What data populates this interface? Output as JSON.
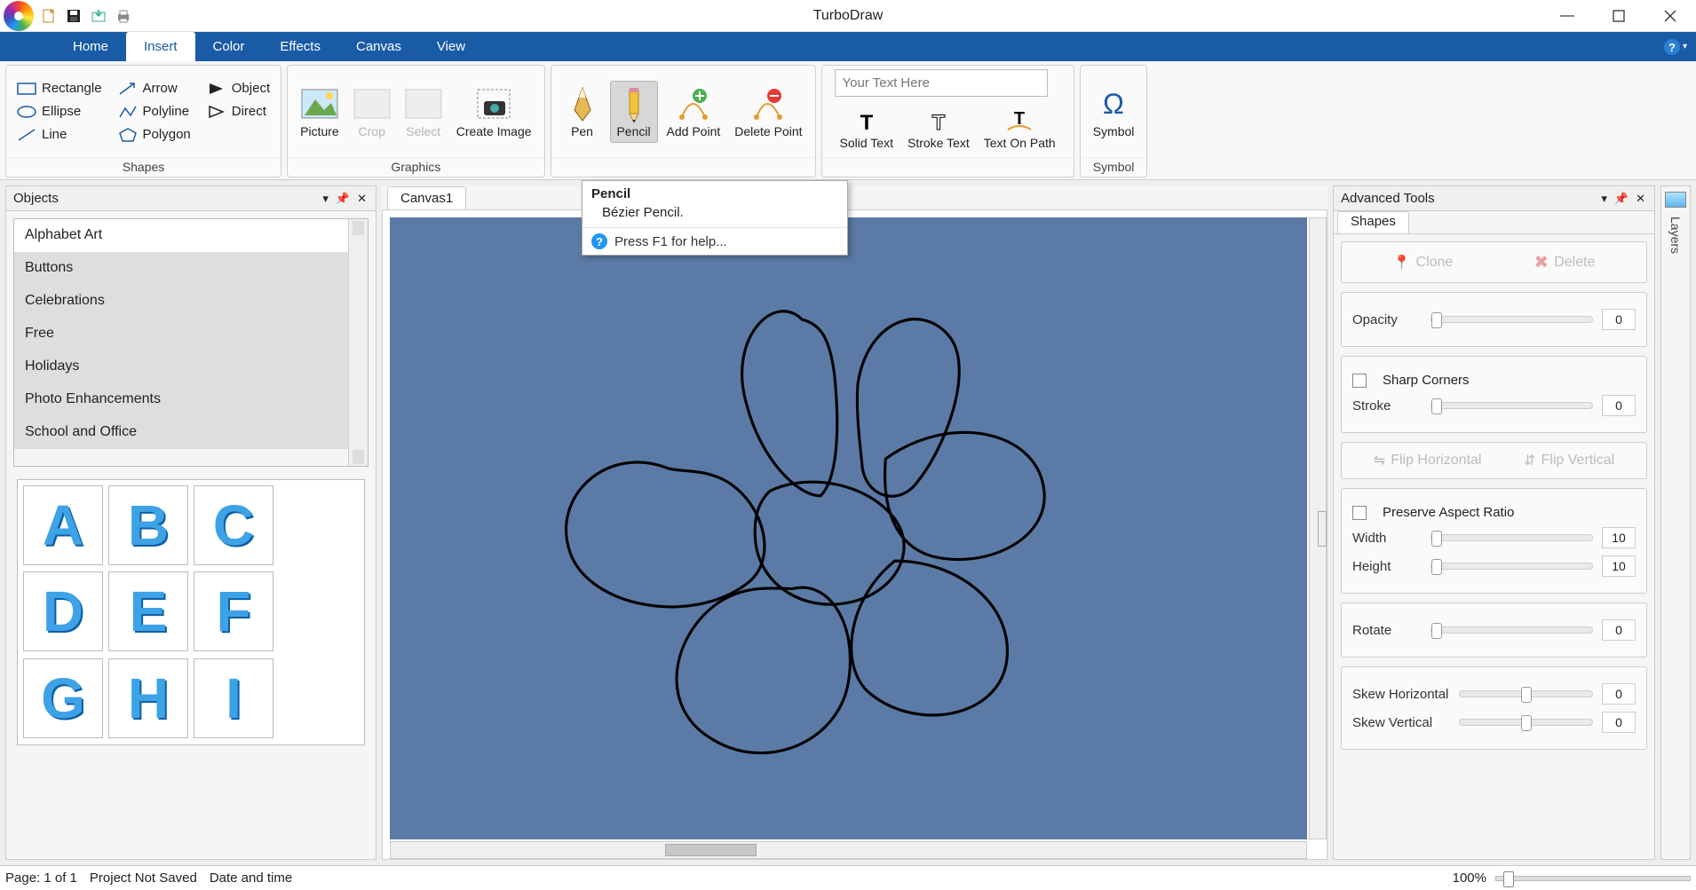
{
  "app": {
    "title": "TurboDraw"
  },
  "qat": {
    "items": [
      "new",
      "save",
      "import",
      "print"
    ]
  },
  "window_controls": {
    "min": "–",
    "max": "□",
    "close": "✕"
  },
  "ribbon": {
    "tabs": [
      "Home",
      "Insert",
      "Color",
      "Effects",
      "Canvas",
      "View"
    ],
    "active_index": 1,
    "groups": {
      "shapes": {
        "label": "Shapes",
        "items": [
          "Rectangle",
          "Arrow",
          "Object",
          "Ellipse",
          "Polyline",
          "Direct",
          "Line",
          "Polygon"
        ]
      },
      "graphics": {
        "label": "Graphics",
        "items": [
          "Picture",
          "Crop",
          "Select",
          "Create Image"
        ]
      },
      "draw": {
        "label": "",
        "items": [
          "Pen",
          "Pencil",
          "Add Point",
          "Delete Point"
        ],
        "active_tool": "Pencil"
      },
      "text": {
        "label": "",
        "placeholder": "Your Text Here",
        "value": "",
        "items": [
          "Solid Text",
          "Stroke Text",
          "Text On Path"
        ]
      },
      "symbol": {
        "label": "Symbol",
        "items": [
          "Symbol"
        ]
      }
    }
  },
  "tooltip": {
    "title": "Pencil",
    "body": "Bézier Pencil.",
    "help": "Press F1 for help..."
  },
  "objects_panel": {
    "title": "Objects",
    "categories": [
      "Alphabet Art",
      "Buttons",
      "Celebrations",
      "Free",
      "Holidays",
      "Photo Enhancements",
      "School and Office"
    ],
    "thumbs": [
      "A",
      "B",
      "C",
      "D",
      "E",
      "F",
      "G",
      "H",
      "I"
    ]
  },
  "canvas": {
    "tabs": [
      "Canvas1"
    ],
    "active": 0
  },
  "advanced": {
    "title": "Advanced Tools",
    "tab": "Shapes",
    "clone": "Clone",
    "delete": "Delete",
    "opacity": {
      "label": "Opacity",
      "value": "0"
    },
    "sharp_corners": "Sharp Corners",
    "stroke": {
      "label": "Stroke",
      "value": "0"
    },
    "flip_h": "Flip Horizontal",
    "flip_v": "Flip Vertical",
    "preserve": "Preserve Aspect Ratio",
    "width": {
      "label": "Width",
      "value": "10"
    },
    "height": {
      "label": "Height",
      "value": "10"
    },
    "rotate": {
      "label": "Rotate",
      "value": "0"
    },
    "skew_h": {
      "label": "Skew Horizontal",
      "value": "0"
    },
    "skew_v": {
      "label": "Skew Vertical",
      "value": "0"
    }
  },
  "layers_tab": "Layers",
  "status": {
    "page": "Page: 1 of 1",
    "project": "Project Not Saved",
    "datetime": "Date and time",
    "zoom": "100%"
  }
}
